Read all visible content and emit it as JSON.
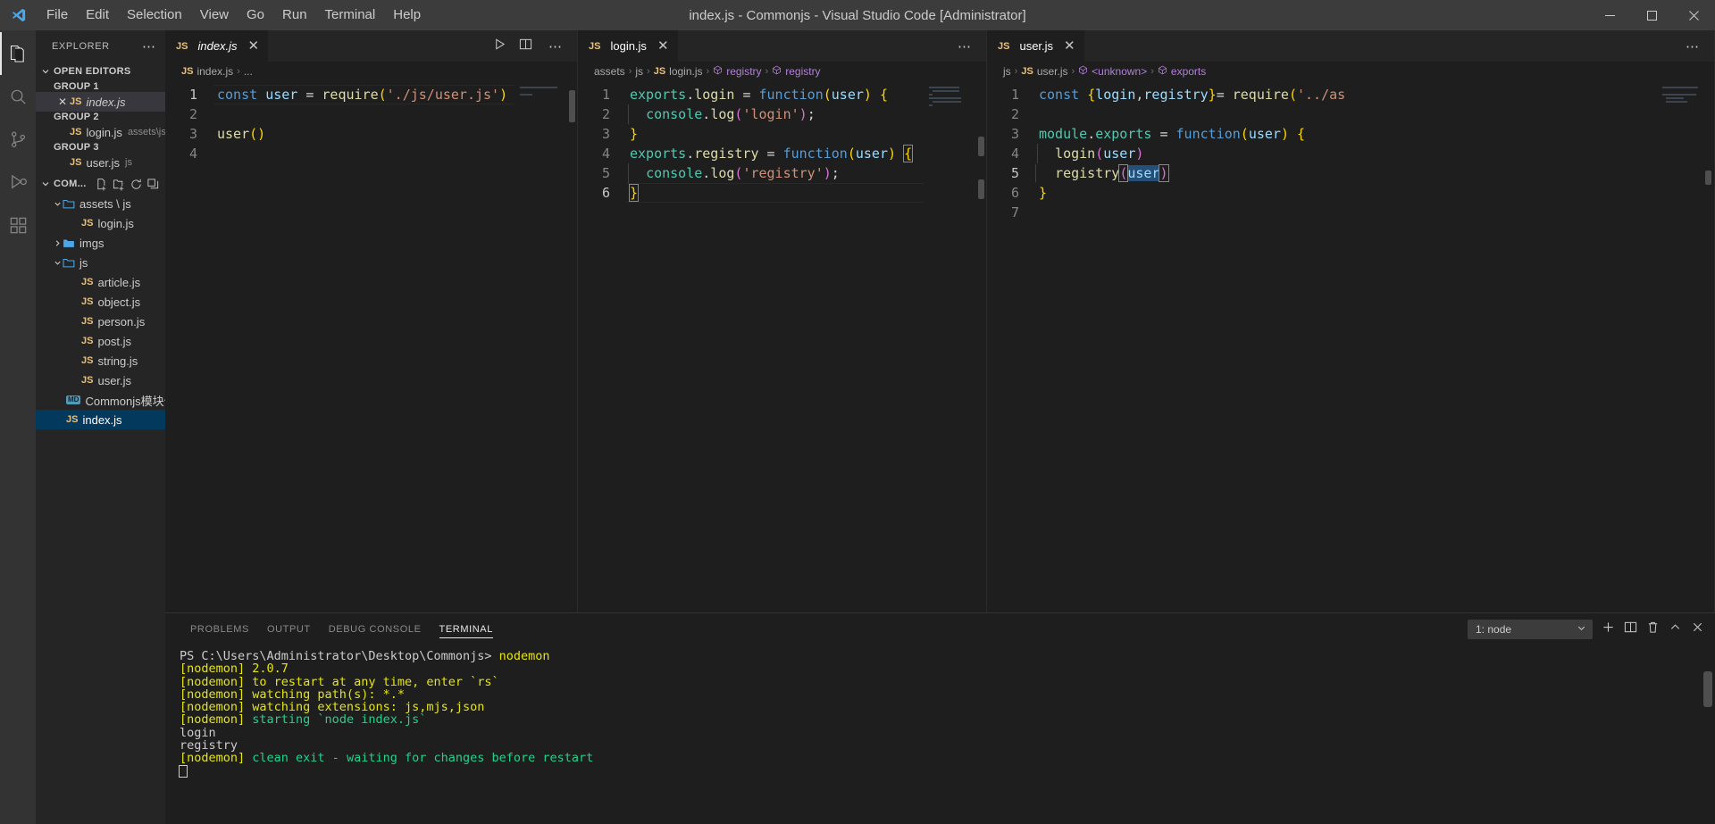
{
  "window": {
    "title": "index.js - Commonjs - Visual Studio Code [Administrator]",
    "minimize": "─",
    "maximize": "❐",
    "close": "✕"
  },
  "menu": [
    "File",
    "Edit",
    "Selection",
    "View",
    "Go",
    "Run",
    "Terminal",
    "Help"
  ],
  "activitybar": [
    {
      "name": "explorer-icon",
      "label": "Explorer",
      "active": true
    },
    {
      "name": "search-icon",
      "label": "Search",
      "active": false
    },
    {
      "name": "source-control-icon",
      "label": "Source Control",
      "active": false
    },
    {
      "name": "run-debug-icon",
      "label": "Run and Debug",
      "active": false
    },
    {
      "name": "extensions-icon",
      "label": "Extensions",
      "active": false
    }
  ],
  "sidebar": {
    "title": "EXPLORER",
    "more": "⋯",
    "open_editors": {
      "label": "OPEN EDITORS",
      "groups": [
        {
          "label": "GROUP 1",
          "items": [
            {
              "name": "index.js",
              "badge": "JS",
              "path": "",
              "active": true,
              "dirty": false,
              "italic": true
            }
          ]
        },
        {
          "label": "GROUP 2",
          "items": [
            {
              "name": "login.js",
              "badge": "JS",
              "path": "assets\\js",
              "active": false,
              "dirty": false,
              "italic": false
            }
          ]
        },
        {
          "label": "GROUP 3",
          "items": [
            {
              "name": "user.js",
              "badge": "JS",
              "path": "js",
              "active": false,
              "dirty": false,
              "italic": false
            }
          ]
        }
      ]
    },
    "workspace": {
      "label": "COM...",
      "actions": [
        "new-file-icon",
        "new-folder-icon",
        "refresh-icon",
        "collapse-all-icon"
      ],
      "tree": [
        {
          "type": "folder",
          "name": "assets \\ js",
          "expanded": true,
          "depth": 1
        },
        {
          "type": "file",
          "name": "login.js",
          "badge": "JS",
          "depth": 2
        },
        {
          "type": "folder",
          "name": "imgs",
          "expanded": false,
          "depth": 1
        },
        {
          "type": "folder",
          "name": "js",
          "expanded": true,
          "depth": 1
        },
        {
          "type": "file",
          "name": "article.js",
          "badge": "JS",
          "depth": 2
        },
        {
          "type": "file",
          "name": "object.js",
          "badge": "JS",
          "depth": 2
        },
        {
          "type": "file",
          "name": "person.js",
          "badge": "JS",
          "depth": 2
        },
        {
          "type": "file",
          "name": "post.js",
          "badge": "JS",
          "depth": 2
        },
        {
          "type": "file",
          "name": "string.js",
          "badge": "JS",
          "depth": 2
        },
        {
          "type": "file",
          "name": "user.js",
          "badge": "JS",
          "depth": 2
        },
        {
          "type": "file",
          "name": "Commonjs模块化...",
          "badge": "MD",
          "depth": 1
        },
        {
          "type": "file",
          "name": "index.js",
          "badge": "JS",
          "depth": 1,
          "selected": true
        }
      ]
    }
  },
  "editor_groups": [
    {
      "tab": {
        "badge": "JS",
        "label": "index.js",
        "italic": true,
        "close": "✕"
      },
      "actions": [
        "run-icon",
        "split-editor-icon",
        "more-actions-icon"
      ],
      "breadcrumb": [
        {
          "kind": "js",
          "text": "JS"
        },
        {
          "kind": "text",
          "text": "index.js"
        },
        {
          "kind": "sep",
          "text": "›"
        },
        {
          "kind": "text",
          "text": "..."
        }
      ],
      "lines": [
        {
          "num": "1",
          "highlight": true
        },
        {
          "num": "2",
          "highlight": false
        },
        {
          "num": "3",
          "highlight": false
        },
        {
          "num": "4",
          "highlight": false
        }
      ],
      "code": {
        "l1": [
          "const",
          " ",
          "user",
          " ",
          "=",
          " ",
          "require",
          "(",
          "'./js/user.js'",
          ")"
        ],
        "l3": [
          "user",
          "(",
          ")"
        ]
      }
    },
    {
      "tab": {
        "badge": "JS",
        "label": "login.js",
        "italic": false,
        "close": "✕"
      },
      "actions": [
        "more-actions-icon"
      ],
      "breadcrumb": [
        {
          "kind": "text",
          "text": "assets"
        },
        {
          "kind": "sep",
          "text": "›"
        },
        {
          "kind": "text",
          "text": "js"
        },
        {
          "kind": "sep",
          "text": "›"
        },
        {
          "kind": "js",
          "text": "JS"
        },
        {
          "kind": "text",
          "text": "login.js"
        },
        {
          "kind": "sep",
          "text": "›"
        },
        {
          "kind": "sym",
          "text": "registry"
        },
        {
          "kind": "sep",
          "text": "›"
        },
        {
          "kind": "sym",
          "text": "registry"
        }
      ],
      "lines": [
        {
          "num": "1"
        },
        {
          "num": "2"
        },
        {
          "num": "3"
        },
        {
          "num": "4"
        },
        {
          "num": "5"
        },
        {
          "num": "6"
        }
      ],
      "code": {
        "l1": [
          "exports",
          ".",
          "login",
          " ",
          "=",
          " ",
          "function",
          "(",
          "user",
          ")",
          " ",
          "{"
        ],
        "l2": [
          "console",
          ".",
          "log",
          "(",
          "'login'",
          ")",
          ";"
        ],
        "l3": [
          "}"
        ],
        "l4": [
          "exports",
          ".",
          "registry",
          " ",
          "=",
          " ",
          "function",
          "(",
          "user",
          ")",
          " ",
          "{"
        ],
        "l5": [
          "console",
          ".",
          "log",
          "(",
          "'registry'",
          ")",
          ";"
        ],
        "l6": [
          "}"
        ]
      }
    },
    {
      "tab": {
        "badge": "JS",
        "label": "user.js",
        "italic": false,
        "close": "✕"
      },
      "actions": [
        "more-actions-icon"
      ],
      "breadcrumb": [
        {
          "kind": "text",
          "text": "js"
        },
        {
          "kind": "sep",
          "text": "›"
        },
        {
          "kind": "js",
          "text": "JS"
        },
        {
          "kind": "text",
          "text": "user.js"
        },
        {
          "kind": "sep",
          "text": "›"
        },
        {
          "kind": "sym",
          "text": "<unknown>"
        },
        {
          "kind": "sep",
          "text": "›"
        },
        {
          "kind": "sym",
          "text": "exports"
        }
      ],
      "lines": [
        {
          "num": "1"
        },
        {
          "num": "2"
        },
        {
          "num": "3"
        },
        {
          "num": "4"
        },
        {
          "num": "5"
        },
        {
          "num": "6"
        },
        {
          "num": "7"
        }
      ],
      "code": {
        "l1": [
          "const",
          " ",
          "{",
          "login",
          ",",
          "registry",
          "}",
          "=",
          " ",
          "require",
          "(",
          "'../as"
        ],
        "l3": [
          "module",
          ".",
          "exports",
          " ",
          "=",
          " ",
          "function",
          "(",
          "user",
          ")",
          " ",
          "{"
        ],
        "l4": [
          "login",
          "(",
          "user",
          ")"
        ],
        "l5": [
          "registry",
          "(",
          "user",
          ")"
        ],
        "l6": [
          "}"
        ]
      }
    }
  ],
  "panel": {
    "tabs": [
      {
        "label": "PROBLEMS",
        "active": false
      },
      {
        "label": "OUTPUT",
        "active": false
      },
      {
        "label": "DEBUG CONSOLE",
        "active": false
      },
      {
        "label": "TERMINAL",
        "active": true
      }
    ],
    "terminal_select": {
      "value": "1: node",
      "chevron": "⌄"
    },
    "actions": [
      "new-terminal-icon",
      "split-terminal-icon",
      "kill-terminal-icon",
      "chevron-up-icon",
      "close-panel-icon"
    ],
    "terminal_lines": [
      {
        "segments": [
          {
            "text": "PS C:\\Users\\Administrator\\Desktop\\Commonjs> ",
            "color": "white"
          },
          {
            "text": "nodemon",
            "color": "yellow"
          }
        ]
      },
      {
        "segments": [
          {
            "text": "[nodemon] 2.0.7",
            "color": "yellow"
          }
        ]
      },
      {
        "segments": [
          {
            "text": "[nodemon] to restart at any time, enter `rs`",
            "color": "yellow"
          }
        ]
      },
      {
        "segments": [
          {
            "text": "[nodemon] watching path(s): *.*",
            "color": "yellow"
          }
        ]
      },
      {
        "segments": [
          {
            "text": "[nodemon] watching extensions: js,mjs,json",
            "color": "yellow"
          }
        ]
      },
      {
        "segments": [
          {
            "text": "[nodemon] ",
            "color": "yellow"
          },
          {
            "text": "starting `node index.js`",
            "color": "green"
          }
        ]
      },
      {
        "segments": [
          {
            "text": "login",
            "color": "white"
          }
        ]
      },
      {
        "segments": [
          {
            "text": "registry",
            "color": "white"
          }
        ]
      },
      {
        "segments": [
          {
            "text": "[nodemon] ",
            "color": "yellow"
          },
          {
            "text": "clean exit - waiting for changes before restart",
            "color": "green"
          }
        ]
      }
    ]
  },
  "colors": {
    "accent": "#0e639c",
    "titlebar_bg": "#3c3c3c",
    "sidebar_bg": "#252526",
    "editor_bg": "#1e1e1e",
    "selection_bg": "#04395e",
    "terminal_yellow": "#e5e510",
    "terminal_green": "#23d18b"
  }
}
